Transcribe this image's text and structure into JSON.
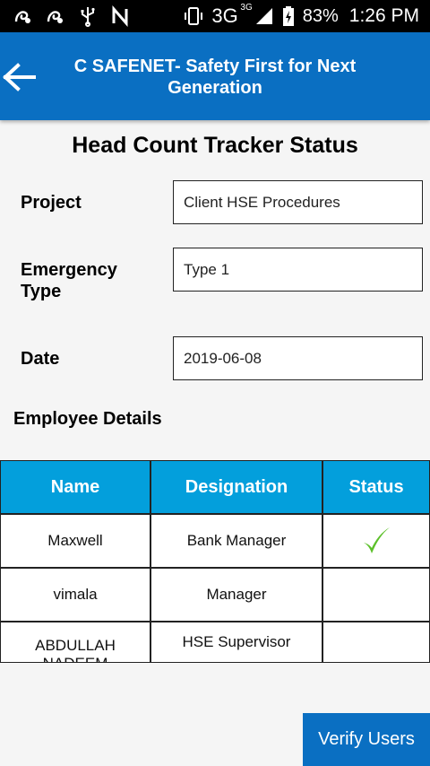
{
  "status_bar": {
    "network": "3G",
    "network_sub": "3G",
    "battery": "83%",
    "time": "1:26 PM"
  },
  "app_bar": {
    "title": "C SAFENET- Safety First for Next Generation"
  },
  "page": {
    "heading": "Head Count Tracker Status"
  },
  "form": {
    "project_label": "Project",
    "project_value": "Client HSE Procedures",
    "emergency_label": "Emergency Type",
    "emergency_value": "Type 1",
    "date_label": "Date",
    "date_value": "2019-06-08"
  },
  "employees": {
    "section_label": "Employee Details",
    "columns": [
      "Name",
      "Designation",
      "Status"
    ],
    "rows": [
      {
        "name": "Maxwell",
        "designation": "Bank Manager",
        "status": "checked"
      },
      {
        "name": "vimala",
        "designation": "Manager",
        "status": ""
      },
      {
        "name": "ABDULLAH NADEEM",
        "designation": "HSE Supervisor",
        "status": ""
      }
    ]
  },
  "actions": {
    "verify_label": "Verify Users"
  },
  "colors": {
    "app_bar": "#0a6fc2",
    "table_header": "#039fdc",
    "check": "#5cc02a"
  }
}
